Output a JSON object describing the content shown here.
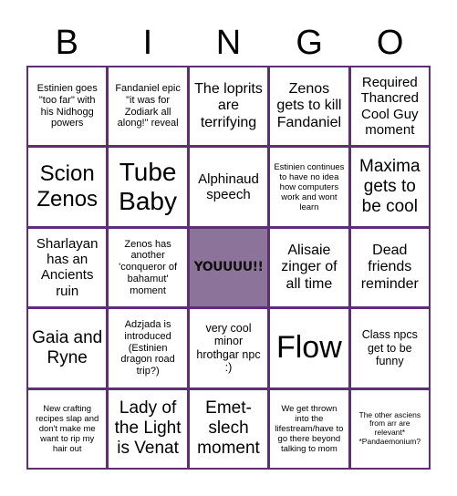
{
  "header": {
    "letters": [
      "B",
      "I",
      "N",
      "G",
      "O"
    ]
  },
  "colors": {
    "grid_border": "#5e2f73",
    "free_cell": "#8c7399",
    "cell_bg": "#ffffff",
    "text": "#000000"
  },
  "cells": [
    [
      "Estinien goes \"too far\" with his Nidhogg powers",
      "Fandaniel epic \"it was for Zodiark all along!\" reveal",
      "The loprits are terrifying",
      "Zenos gets to kill Fandaniel",
      "Required Thancred Cool Guy moment"
    ],
    [
      "Scion Zenos",
      "Tube Baby",
      "Alphinaud speech",
      "Estinien continues to have no idea how computers work and wont learn",
      "Maxima gets to be cool"
    ],
    [
      "Sharlayan has an Ancients ruin",
      "Zenos has another 'conqueror of bahamut' moment",
      "YOUUUU!!",
      "Alisaie zinger of all time",
      "Dead friends reminder"
    ],
    [
      "Gaia and Ryne",
      "Adzjada is introduced (Estinien dragon road trip?)",
      "very cool minor hrothgar npc :)",
      "Flow",
      "Class npcs get to be funny"
    ],
    [
      "New crafting recipes slap and don't make me want to rip my hair out",
      "Lady of the Light is Venat",
      "Emet-slech moment",
      "We get thrown into the lifestream/have to go there beyond talking to mom",
      "The other asciens from arr are relevant* *Pandaemonium?"
    ]
  ],
  "free_cell": {
    "row": 2,
    "col": 2
  }
}
